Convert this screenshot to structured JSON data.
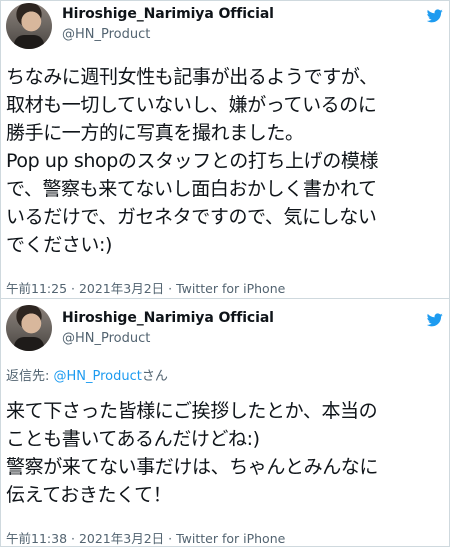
{
  "colors": {
    "text": "#0f1419",
    "secondary": "#536471",
    "link": "#1d9bf0",
    "border": "#cfd9de",
    "brand": "#1d9bf0"
  },
  "tweets": [
    {
      "author": {
        "display_name": "Hiroshige_Narimiya Official",
        "handle": "@HN_Product",
        "avatar_icon": "avatar-photo"
      },
      "brand_icon": "twitter-bird-icon",
      "text": "ちなみに週刊女性も記事が出るようですが、\n取材も一切していないし、嫌がっているのに\n勝手に一方的に写真を撮れました。\nPop up shopのスタッフとの打ち上げの模様\nで、警察も来てないし面白おかしく書かれて\nいるだけで、ガセネタですので、気にしない\nでください:)",
      "meta": "午前11:25 · 2021年3月2日 · Twitter for iPhone"
    },
    {
      "author": {
        "display_name": "Hiroshige_Narimiya Official",
        "handle": "@HN_Product",
        "avatar_icon": "avatar-photo"
      },
      "brand_icon": "twitter-bird-icon",
      "reply": {
        "prefix": "返信先: ",
        "mention": "@HN_Product",
        "suffix": "さん"
      },
      "text": "来て下さった皆様にご挨拶したとか、本当の\nことも書いてあるんだけどね:)\n警察が来てない事だけは、ちゃんとみんなに\n伝えておきたくて！",
      "meta": "午前11:38 · 2021年3月2日 · Twitter for iPhone"
    }
  ]
}
